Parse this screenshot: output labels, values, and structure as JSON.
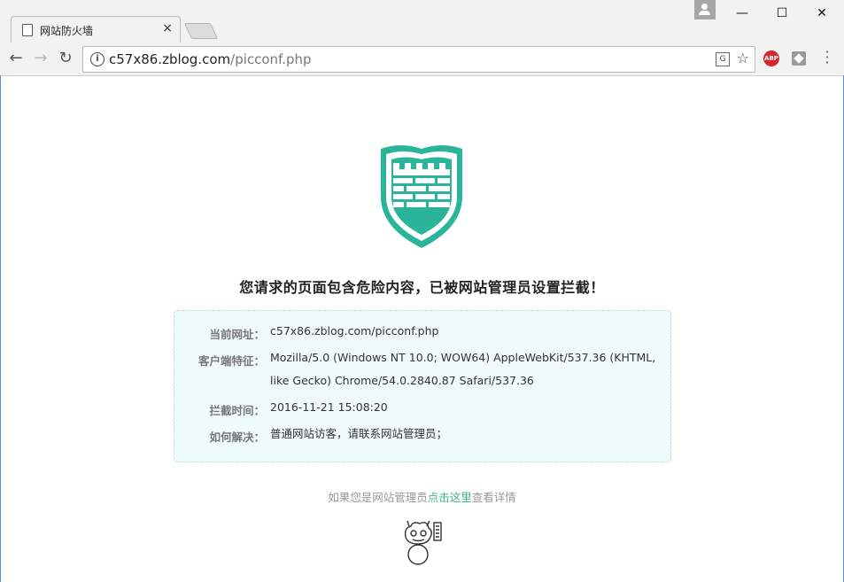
{
  "browser": {
    "tab_title": "网站防火墙",
    "tab_close": "×",
    "window_minimize": "—",
    "window_maximize": "☐",
    "window_close": "✕",
    "url_host": "c57x86.zblog.com",
    "url_path": "/picconf.php",
    "ext_abp_label": "ABP"
  },
  "page": {
    "headline": "您请求的页面包含危险内容，已被网站管理员设置拦截！",
    "details": [
      {
        "label": "当前网址：",
        "value": "c57x86.zblog.com/picconf.php"
      },
      {
        "label": "客户端特征：",
        "value": "Mozilla/5.0 (Windows NT 10.0; WOW64) AppleWebKit/537.36 (KHTML, like Gecko) Chrome/54.0.2840.87 Safari/537.36"
      },
      {
        "label": "拦截时间：",
        "value": "2016-11-21 15:08:20"
      },
      {
        "label": "如何解决：",
        "value": "普通网站访客，请联系网站管理员；"
      }
    ],
    "admin_prefix": "如果您是网站管理员",
    "admin_link": "点击这里",
    "admin_suffix": "查看详情"
  },
  "colors": {
    "accent": "#2ab59b",
    "box_bg": "#effafa"
  }
}
